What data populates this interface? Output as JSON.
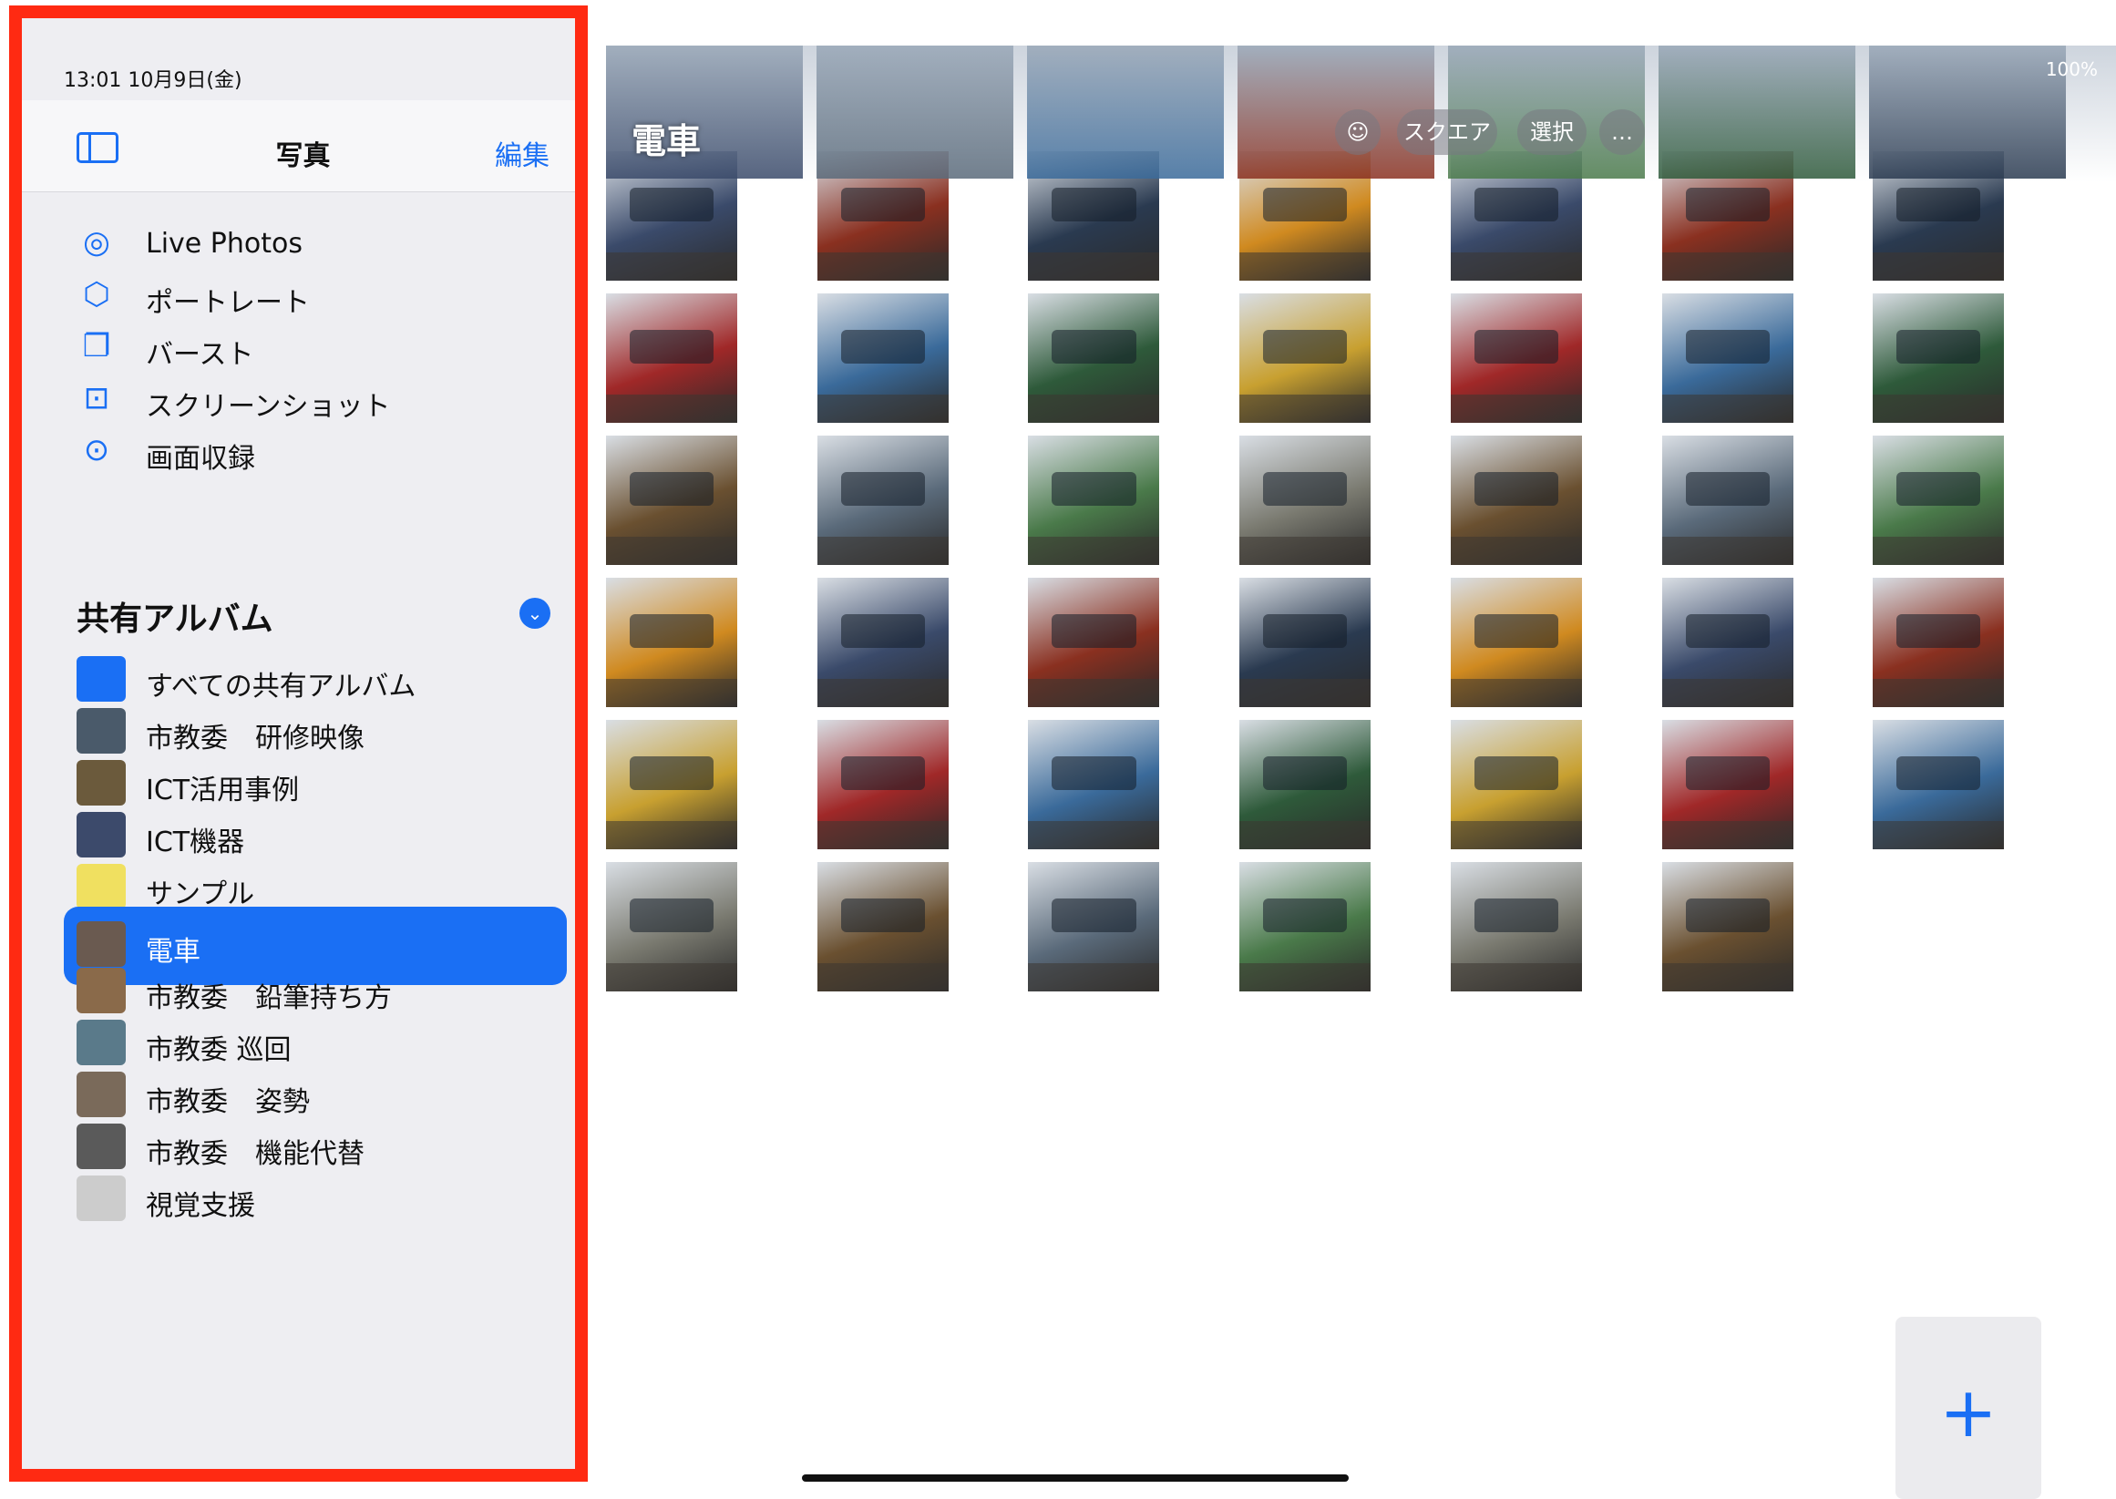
{
  "status": {
    "time": "13:01  10月9日(金)",
    "right": "100%"
  },
  "sidebar": {
    "title": "写真",
    "edit_label": "編集",
    "media_types": [
      {
        "label": "Live Photos",
        "icon": "live-photos-icon"
      },
      {
        "label": "ポートレート",
        "icon": "portrait-cube-icon"
      },
      {
        "label": "バースト",
        "icon": "burst-icon"
      },
      {
        "label": "スクリーンショット",
        "icon": "screenshot-icon"
      },
      {
        "label": "画面収録",
        "icon": "screen-recording-icon"
      }
    ],
    "shared_section": "共有アルバム",
    "albums": [
      {
        "label": "すべての共有アルバム",
        "color": "#1a6ff4"
      },
      {
        "label": "市教委　研修映像",
        "color": "#4a5a6a"
      },
      {
        "label": "ICT活用事例",
        "color": "#6b5a3c"
      },
      {
        "label": "ICT機器",
        "color": "#3c4a6b"
      },
      {
        "label": "サンプル",
        "color": "#f0e060"
      },
      {
        "label": "電車",
        "color": "#6a5a50",
        "selected": true
      },
      {
        "label": "市教委　鉛筆持ち方",
        "color": "#8a6a4a"
      },
      {
        "label": "市教委 巡回",
        "color": "#5a7a8a"
      },
      {
        "label": "市教委　姿勢",
        "color": "#7a6a5a"
      },
      {
        "label": "市教委　機能代替",
        "color": "#5a5a5a"
      },
      {
        "label": "視覚支援",
        "color": "#cccccc"
      }
    ]
  },
  "main": {
    "title": "電車",
    "buttons": {
      "square": "スクエア",
      "select": "選択",
      "more": "…"
    },
    "add_label": "+"
  },
  "colors": {
    "accent": "#1a6ff4",
    "frame": "#ff2a12"
  }
}
